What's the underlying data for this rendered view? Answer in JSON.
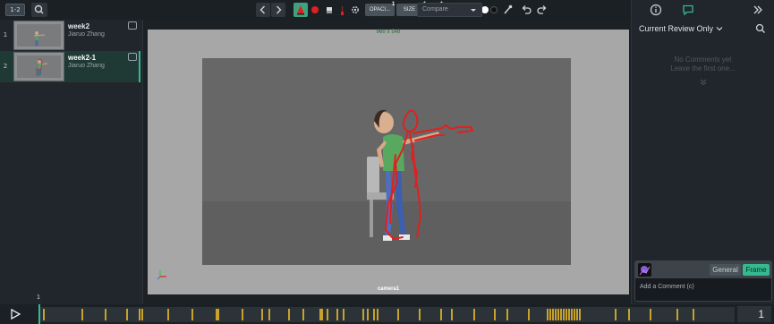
{
  "colors": {
    "accent": "#35b98f",
    "brush_red": "#e02020",
    "selected_color": "#e00000",
    "palette": [
      "#e02020",
      "#f0e040",
      "#40c040",
      "#ffffff",
      "#111111"
    ],
    "timeline_marker": "#c9a227"
  },
  "left_panel": {
    "grid_toggle_label": "1-2",
    "shots": [
      {
        "number": "1",
        "title": "week2",
        "author": "Jiaruo Zhang",
        "active": false
      },
      {
        "number": "2",
        "title": "week2-1",
        "author": "Jiaruo Zhang",
        "active": true
      }
    ]
  },
  "toolbar": {
    "prev_icon": "chevron-left-icon",
    "next_icon": "chevron-right-icon",
    "opacity_label": "OPACI...",
    "opacity_value": "1",
    "size_label": "SIZE",
    "size_value": "1",
    "color_value": "1",
    "compare_label": "Compare"
  },
  "viewer": {
    "resolution": "960 x 540",
    "camera": "camera1"
  },
  "right_panel": {
    "filter_label": "Current Review Only",
    "empty_line1": "No Comments yet",
    "empty_line2": "Leave the first one...",
    "tab_general": "General",
    "tab_frame": "Frame",
    "comment_placeholder": "Add a Comment (c)"
  },
  "timeline": {
    "start_frame": "1",
    "current_frame": "1",
    "markers": [
      48,
      91,
      117,
      141,
      155,
      158,
      187,
      214,
      241,
      243,
      270,
      292,
      300,
      322,
      338,
      357,
      359,
      365,
      376,
      383,
      405,
      410,
      417,
      421,
      444,
      468,
      492,
      504,
      529,
      552,
      566,
      590,
      611,
      614,
      617,
      620,
      623,
      626,
      629,
      632,
      635,
      638,
      641,
      644,
      647,
      687,
      702,
      726,
      756,
      774
    ]
  }
}
